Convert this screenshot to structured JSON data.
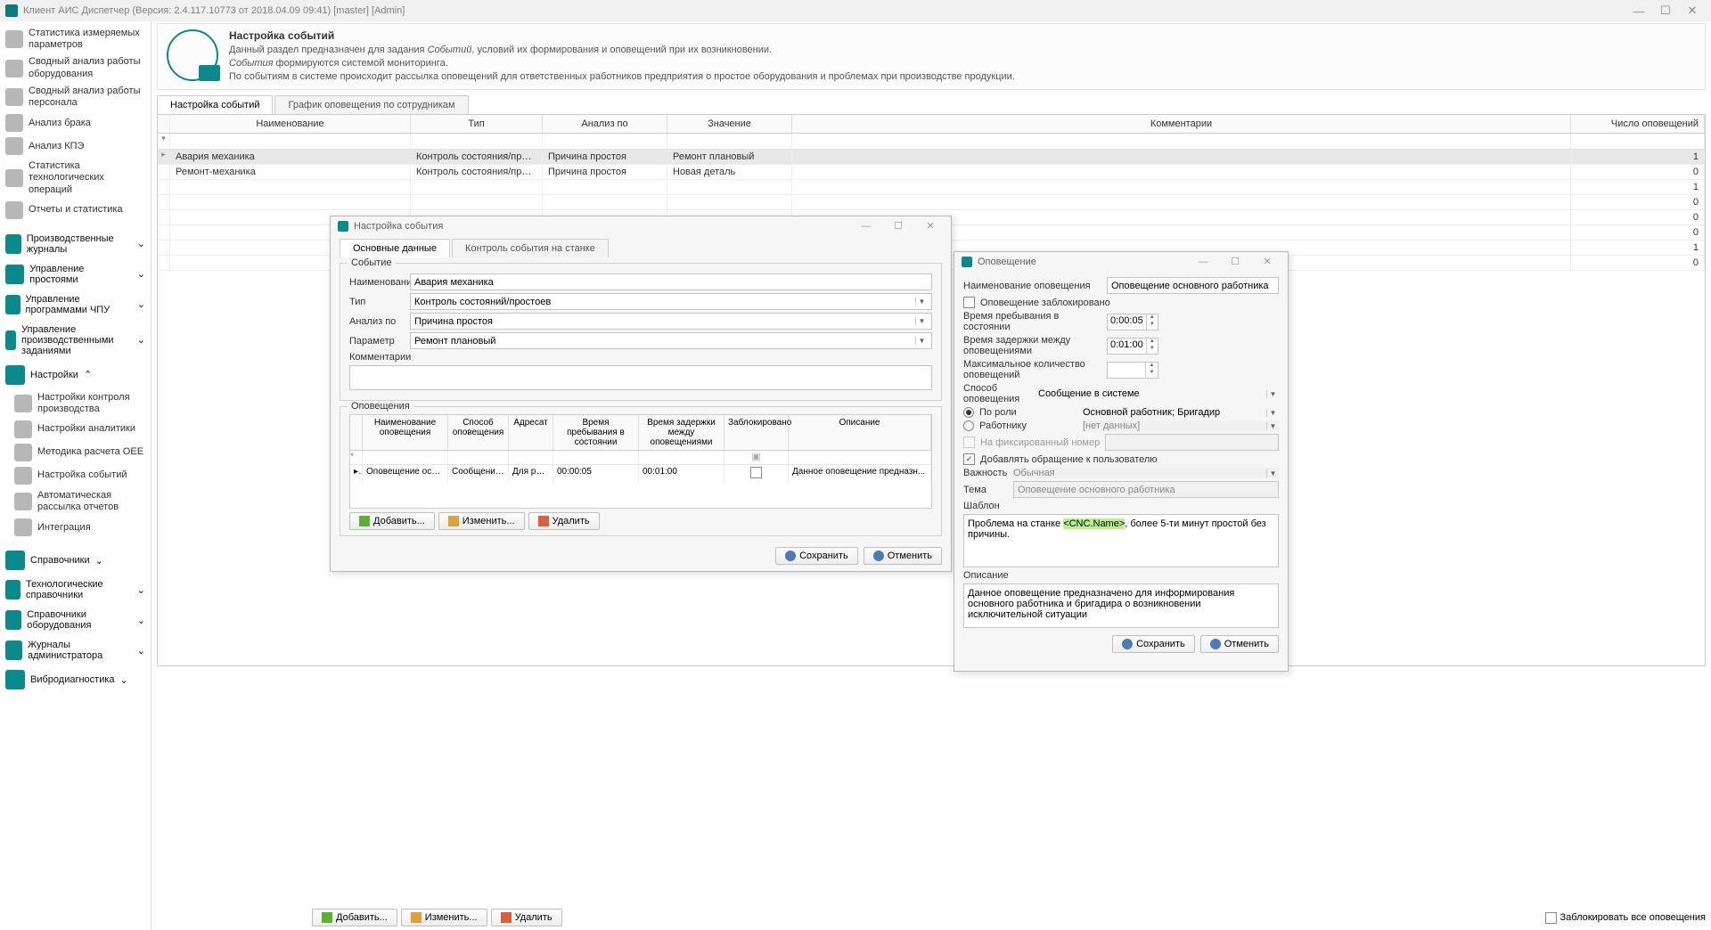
{
  "title": "Клиент АИС Диспетчер (Версия: 2.4.117.10773 от 2018.04.09 09:41)  [master]   [Admin]",
  "sidebar": {
    "top": [
      "Статистика измеряемых параметров",
      "Сводный анализ работы оборудования",
      "Сводный анализ работы персонала",
      "Анализ брака",
      "Анализ КПЭ",
      "Статистика технологических операций",
      "Отчеты и статистика"
    ],
    "groups1": [
      "Производственные журналы",
      "Управление простоями",
      "Управление программами ЧПУ",
      "Управление производственными заданиями"
    ],
    "settings": "Настройки",
    "settings_sub": [
      "Настройки контроля производства",
      "Настройки аналитики",
      "Методика расчета OEE",
      "Настройка событий",
      "Автоматическая рассылка отчетов",
      "Интеграция"
    ],
    "groups2": [
      "Справочники",
      "Технологические справочники",
      "Справочники оборудования",
      "Журналы администратора",
      "Вибродиагностика"
    ]
  },
  "header": {
    "title": "Настройка событий",
    "l1a": "Данный раздел предназначен для задания ",
    "l1b": "Событий",
    "l1c": ", условий их формирования и оповещений при их возникновении.",
    "l2a": "События",
    "l2b": " формируются системой мониторинга.",
    "l3": "По событиям в системе происходит рассылка оповещений для ответственных работников предприятия о простое оборудования и проблемах при производстве продукции."
  },
  "tabs": {
    "t1": "Настройка событий",
    "t2": "График оповещения по сотрудникам"
  },
  "grid": {
    "cols": [
      "Наименование",
      "Тип",
      "Анализ по",
      "Значение",
      "Комментарии",
      "Число оповещений"
    ],
    "rows": [
      {
        "name": "Авария механика",
        "type": "Контроль состояния/причины п...",
        "analiz": "Причина простоя",
        "val": "Ремонт плановый",
        "comm": "",
        "cnt": "1"
      },
      {
        "name": "Ремонт-механика",
        "type": "Контроль состояния/причины п...",
        "analiz": "Причина простоя",
        "val": "Новая деталь",
        "comm": "",
        "cnt": "0"
      }
    ],
    "tail_counts": [
      "1",
      "0",
      "0",
      "0",
      "1",
      "0"
    ]
  },
  "dlg1": {
    "title": "Настройка события",
    "tab1": "Основные данные",
    "tab2": "Контроль события на станке",
    "legend1": "Событие",
    "labels": {
      "name": "Наименование",
      "type": "Тип",
      "analiz": "Анализ по",
      "param": "Параметр",
      "comm": "Комментарии"
    },
    "vals": {
      "name": "Авария механика",
      "type": "Контроль состояний/простоев",
      "analiz": "Причина простоя",
      "param": "Ремонт плановый"
    },
    "legend2": "Оповещения",
    "subgrid": {
      "cols": [
        "Наименование оповещения",
        "Способ оповещения",
        "Адресат",
        "Время пребывания в состоянии",
        "Время задержки между оповещениями",
        "Заблокировано",
        "Описание"
      ],
      "row": {
        "name": "Оповещение основ...",
        "sposob": "Сообщение в ...",
        "addr": "Для рол...",
        "t1": "00:00:05",
        "t2": "00:01:00",
        "desc": "Данное оповещение предназн..."
      }
    },
    "btns": {
      "add": "Добавить...",
      "edit": "Изменить...",
      "del": "Удалить",
      "save": "Сохранить",
      "cancel": "Отменить"
    }
  },
  "dlg2": {
    "title": "Оповещение",
    "labels": {
      "name": "Наименование оповещения",
      "blocked": "Оповещение заблокировано",
      "t1": "Время пребывания в состоянии",
      "t2": "Время задержки между оповещениями",
      "max": "Максимальное количество оповещений",
      "sposob": "Способ оповещения",
      "porol": "По роли",
      "rabot": "Работнику",
      "fixnum": "На фиксированный номер",
      "addcall": "Добавлять обращение к пользователю",
      "vazh": "Важность",
      "tema": "Тема",
      "shablon": "Шаблон",
      "desc": "Описание"
    },
    "vals": {
      "name": "Оповещение основного работника",
      "t1": "0:00:05",
      "t2": "0:01:00",
      "sposob": "Сообщение в системе",
      "porol": "Основной работник; Бригадир",
      "rabot": "[нет данных]",
      "vazh": "Обычная",
      "tema": "Оповещение основного работника",
      "shablon_a": "Проблема на станке ",
      "shablon_tag": "<CNC.Name>",
      "shablon_b": ", более 5-ти минут простой без причины.",
      "desc": "Данное оповещение предназначено для информирования основного работника и бригадира о возникновении исключительной ситуации"
    },
    "btns": {
      "save": "Сохранить",
      "cancel": "Отменить"
    }
  },
  "bottom": {
    "add": "Добавить...",
    "edit": "Изменить...",
    "del": "Удалить",
    "blockall": "Заблокировать все оповещения"
  }
}
